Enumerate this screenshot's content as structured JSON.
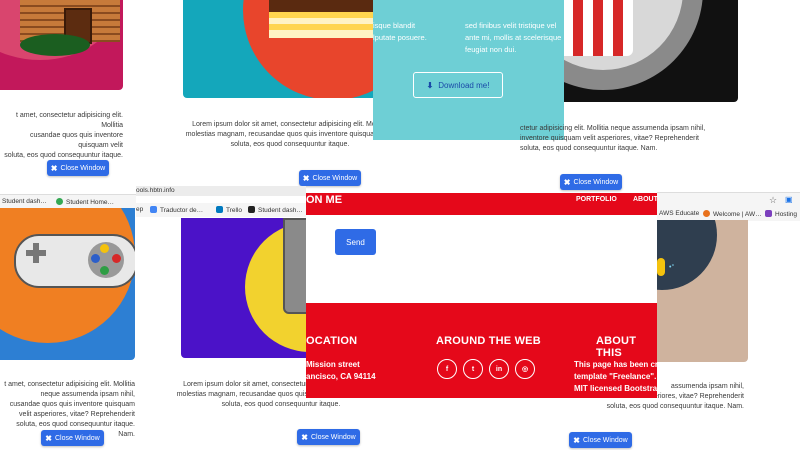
{
  "colors": {
    "primary_button": "#2f6be6",
    "modal_teal": "#6ecfd5",
    "brand_red": "#e5081a",
    "card_teal": "#14a7bb",
    "card_purple": "#4b12c8",
    "card_blue": "#2d7fd3",
    "card_orange": "#f07f22",
    "card_dark": "#111111",
    "card_tan": "#cfb39e"
  },
  "lorem_partial_left": [
    "t amet, consectetur adipisicing elit. Mollitia",
    "cusandae quos quis inventore quisquam velit",
    "soluta, eos quod consequuntur itaque."
  ],
  "lorem_full": [
    "Lorem ipsum dolor sit amet, consectetur adipisicing elit. Mollitia",
    "molestias magnam, recusandae quos quis inventore quisquam velit",
    "soluta, eos quod consequuntur itaque."
  ],
  "lorem_right_top": [
    "ctetur adipisicing elit. Mollitia neque assumenda ipsam nihil,",
    "inventore quisquam velit asperiores, vitae? Reprehenderit",
    "soluta, eos quod consequuntur itaque. Nam."
  ],
  "lorem_left_bottom": [
    "t amet, consectetur adipisicing elit. Mollitia neque assumenda ipsam nihil,",
    "cusandae quos quis inventore quisquam velit asperiores, vitae? Reprehenderit",
    "soluta, eos quod consequuntur itaque. Nam."
  ],
  "lorem_right_bottom": [
    "assumenda ipsam nihil,",
    "eriores, vitae? Reprehenderit",
    "soluta, eos quod consequuntur itaque. Nam."
  ],
  "close_window_label": "Close Window",
  "download_label": "Download me!",
  "modal_text_left": [
    "isque blandit",
    "lputate posuere."
  ],
  "modal_text_right": [
    "sed finibus velit tristique vel",
    "ante mi, mollis at scelerisque",
    "feugiat non dui."
  ],
  "bookmarks_left": [
    "Student dash…",
    "Student Home…"
  ],
  "bookmarks_mid": {
    "url": "ools.hbtn.info",
    "items": [
      "Traductor de…",
      "Trello",
      "Student dash…"
    ],
    "app_prefix": "ep"
  },
  "bookmarks_right": [
    "AWS Educate",
    "Welcome | AW…",
    "Hosting"
  ],
  "navbar": {
    "title_partial": "ON ME",
    "portfolio": "PORTFOLIO",
    "about_partial": "ABOUT"
  },
  "send_label": "Send",
  "footer": {
    "location_heading": "OCATION",
    "location_lines": [
      "Mission street",
      "ancisco, CA 94114"
    ],
    "web_heading": "AROUND THE WEB",
    "social_icons": [
      "f",
      "t",
      "in",
      "◎"
    ],
    "about_heading": "ABOUT THIS",
    "about_lines": [
      "This page has been cre",
      "template \"Freelance\".",
      "MIT licensed Bootstra"
    ]
  }
}
